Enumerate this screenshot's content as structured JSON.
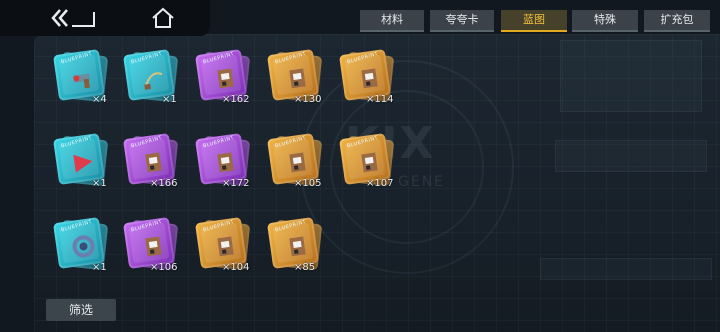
{
  "nav": {
    "back_icon": "back-arrow-icon",
    "home_icon": "home-icon"
  },
  "tabs": [
    {
      "label": "材料",
      "active": false
    },
    {
      "label": "夸夸卡",
      "active": false
    },
    {
      "label": "蓝图",
      "active": true
    },
    {
      "label": "特殊",
      "active": false
    },
    {
      "label": "扩充包",
      "active": false
    }
  ],
  "background": {
    "logo": "KIX",
    "logo_sub": "GENE"
  },
  "card_tag": "BLUEPRINT",
  "items": [
    {
      "rarity": "cyan",
      "icon": "gun-blueprint-icon",
      "count": "×4"
    },
    {
      "rarity": "cyan",
      "icon": "whip-blueprint-icon",
      "count": "×1"
    },
    {
      "rarity": "purple",
      "icon": "key-blueprint-icon",
      "count": "×162"
    },
    {
      "rarity": "gold",
      "icon": "key-blueprint-icon",
      "count": "×130"
    },
    {
      "rarity": "gold",
      "icon": "key-blueprint-icon",
      "count": "×114"
    },
    {
      "rarity": "cyan",
      "icon": "flag-blueprint-icon",
      "count": "×1"
    },
    {
      "rarity": "purple",
      "icon": "key-blueprint-icon",
      "count": "×166"
    },
    {
      "rarity": "purple",
      "icon": "key-blueprint-icon",
      "count": "×172"
    },
    {
      "rarity": "gold",
      "icon": "key-blueprint-icon",
      "count": "×105"
    },
    {
      "rarity": "gold",
      "icon": "key-blueprint-icon",
      "count": "×107"
    },
    {
      "rarity": "cyan",
      "icon": "ring-blueprint-icon",
      "count": "×1"
    },
    {
      "rarity": "purple",
      "icon": "key-blueprint-icon",
      "count": "×106"
    },
    {
      "rarity": "gold",
      "icon": "key-blueprint-icon",
      "count": "×104"
    },
    {
      "rarity": "gold",
      "icon": "key-blueprint-icon",
      "count": "×85"
    }
  ],
  "filter": {
    "label": "筛选"
  },
  "colors": {
    "active_tab": "#f2c23a",
    "cyan": "#39d7e6",
    "purple": "#c66ef2",
    "gold": "#f0b444"
  }
}
